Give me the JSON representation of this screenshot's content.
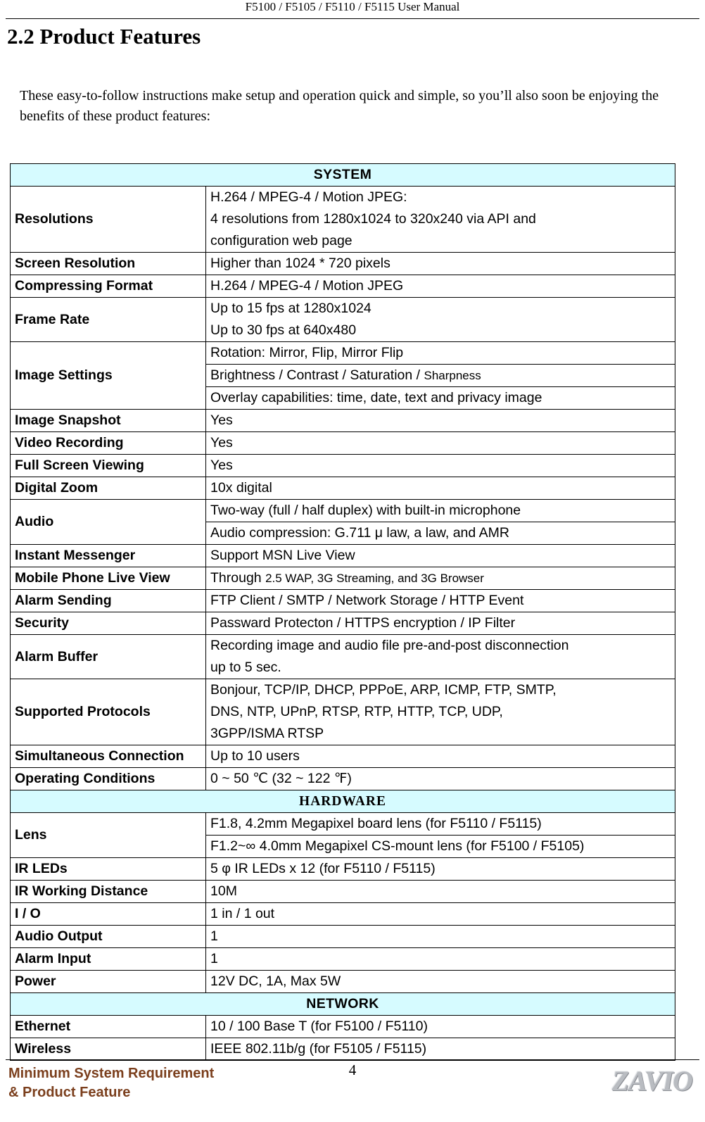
{
  "header": {
    "running_title": "F5100 / F5105 / F5110 / F5115 User Manual"
  },
  "title": "2.2 Product Features",
  "intro": "These easy-to-follow instructions make setup and operation quick and simple, so you’ll also soon be enjoying the benefits of these product features:",
  "sections": {
    "system": "SYSTEM",
    "hardware": "HARDWARE",
    "network": "NETWORK"
  },
  "rows": {
    "resolutions": {
      "label": "Resolutions",
      "line1": "H.264 / MPEG-4 / Motion JPEG:",
      "line2": "4 resolutions from 1280x1024 to 320x240 via API and",
      "line3": "configuration web page"
    },
    "screen_resolution": {
      "label": "Screen Resolution",
      "value": "Higher than 1024 * 720 pixels"
    },
    "compressing_format": {
      "label": "Compressing Format",
      "value": "H.264 / MPEG-4 / Motion JPEG"
    },
    "frame_rate": {
      "label": "Frame Rate",
      "line1": "Up to 15 fps at 1280x1024",
      "line2": "Up to 30 fps at 640x480"
    },
    "image_settings": {
      "label": "Image Settings",
      "line1": "Rotation: Mirror, Flip, Mirror Flip",
      "line2a": "Brightness / Contrast / Saturation / ",
      "line2b": "Sharpness",
      "line3": "Overlay capabilities: time, date, text and privacy image"
    },
    "image_snapshot": {
      "label": "Image Snapshot",
      "value": "Yes"
    },
    "video_recording": {
      "label": "Video Recording",
      "value": "Yes"
    },
    "full_screen_viewing": {
      "label": "Full Screen Viewing",
      "value": "Yes"
    },
    "digital_zoom": {
      "label": "Digital Zoom",
      "value": "10x digital"
    },
    "audio": {
      "label": "Audio",
      "line1": "Two-way (full / half duplex) with built-in microphone",
      "line2": "Audio compression: G.711 μ law, a law, and AMR"
    },
    "instant_messenger": {
      "label": "Instant Messenger",
      "value": "Support MSN Live View"
    },
    "mobile_phone_live_view": {
      "label": "Mobile Phone Live View",
      "value_a": "Through ",
      "value_b": "2.5 WAP, 3G Streaming, and 3G Browser"
    },
    "alarm_sending": {
      "label": "Alarm Sending",
      "value": "FTP Client / SMTP / Network Storage / HTTP Event"
    },
    "security": {
      "label": "Security",
      "value": "Passward Protecton / HTTPS encryption / IP Filter"
    },
    "alarm_buffer": {
      "label": "Alarm Buffer",
      "line1": "Recording image and audio file pre-and-post disconnection",
      "line2": "up to 5 sec."
    },
    "supported_protocols": {
      "label": "Supported Protocols",
      "line1": "Bonjour, TCP/IP, DHCP, PPPoE, ARP, ICMP, FTP, SMTP,",
      "line2": "DNS, NTP, UPnP, RTSP, RTP, HTTP, TCP, UDP,",
      "line3": "3GPP/ISMA RTSP"
    },
    "simultaneous_connection": {
      "label": "Simultaneous Connection",
      "value": "Up to 10 users"
    },
    "operating_conditions": {
      "label": "Operating Conditions",
      "value": "0 ~ 50  ℃  (32 ~ 122  ℉)"
    },
    "lens": {
      "label": "Lens",
      "line1": "F1.8, 4.2mm Megapixel board lens (for F5110 / F5115)",
      "line2": "F1.2~∞  4.0mm Megapixel CS-mount lens (for F5100 / F5105)"
    },
    "ir_leds": {
      "label": "IR LEDs",
      "value": "5 φ IR LEDs x 12 (for F5110 / F5115)"
    },
    "ir_working_distance": {
      "label": "IR Working Distance",
      "value": "10M"
    },
    "io": {
      "label": "I / O",
      "value": "1 in / 1 out"
    },
    "audio_output": {
      "label": "Audio Output",
      "value": "1"
    },
    "alarm_input": {
      "label": "Alarm Input",
      "value": "1"
    },
    "power": {
      "label": "Power",
      "value": "12V DC, 1A, Max 5W"
    },
    "ethernet": {
      "label": "Ethernet",
      "value": "10 / 100 Base T (for F5100 / F5110)"
    },
    "wireless": {
      "label": "Wireless",
      "value": "IEEE 802.11b/g (for F5105 / F5115)"
    }
  },
  "footer": {
    "left_line1": "Minimum System Requirement",
    "left_line2": "& Product Feature",
    "page_number": "4",
    "logo_text": "ZAVIO"
  }
}
